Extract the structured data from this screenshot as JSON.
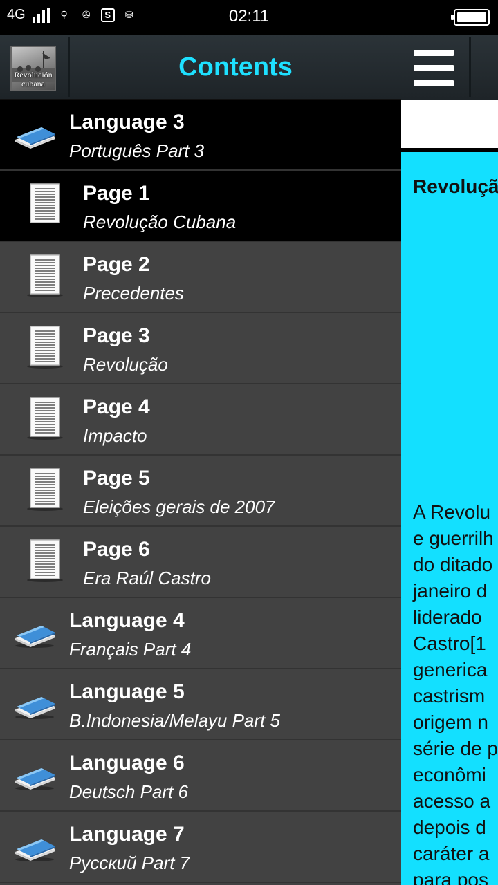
{
  "status_bar": {
    "network": "4G",
    "time": "02:11"
  },
  "drawer": {
    "title": "Contents",
    "app_icon_text": "Revolución cubana",
    "items": [
      {
        "kind": "language",
        "title": "Language 3",
        "subtitle": "Português Part 3",
        "active": true
      },
      {
        "kind": "page",
        "title": "Page 1",
        "subtitle": "Revolução Cubana",
        "active": true
      },
      {
        "kind": "page",
        "title": "Page 2",
        "subtitle": "Precedentes",
        "active": false
      },
      {
        "kind": "page",
        "title": "Page 3",
        "subtitle": "Revolução",
        "active": false
      },
      {
        "kind": "page",
        "title": "Page 4",
        "subtitle": "Impacto",
        "active": false
      },
      {
        "kind": "page",
        "title": "Page 5",
        "subtitle": "Eleições gerais de 2007",
        "active": false
      },
      {
        "kind": "page",
        "title": "Page 6",
        "subtitle": "Era Raúl Castro",
        "active": false
      },
      {
        "kind": "language",
        "title": "Language 4",
        "subtitle": "Français Part 4",
        "active": false
      },
      {
        "kind": "language",
        "title": "Language 5",
        "subtitle": "B.Indonesia/Melayu Part 5",
        "active": false
      },
      {
        "kind": "language",
        "title": "Language 6",
        "subtitle": "Deutsch Part 6",
        "active": false
      },
      {
        "kind": "language",
        "title": "Language 7",
        "subtitle": "Русский Part 7",
        "active": false
      }
    ]
  },
  "main": {
    "doc_title": "Revoluçã",
    "doc_lines": [
      "A Revolu",
      "e guerrilh",
      "do ditado",
      "janeiro d",
      "liderado",
      "Castro[1",
      "generica",
      "castrism",
      "origem n",
      "série de p",
      "econômi",
      "acesso a",
      "depois d",
      "caráter a",
      "para pos"
    ]
  },
  "colors": {
    "accent": "#1ee0ff",
    "content_bg": "#13e0ff",
    "drawer_bg": "#424242",
    "active_row_bg": "#000000"
  }
}
